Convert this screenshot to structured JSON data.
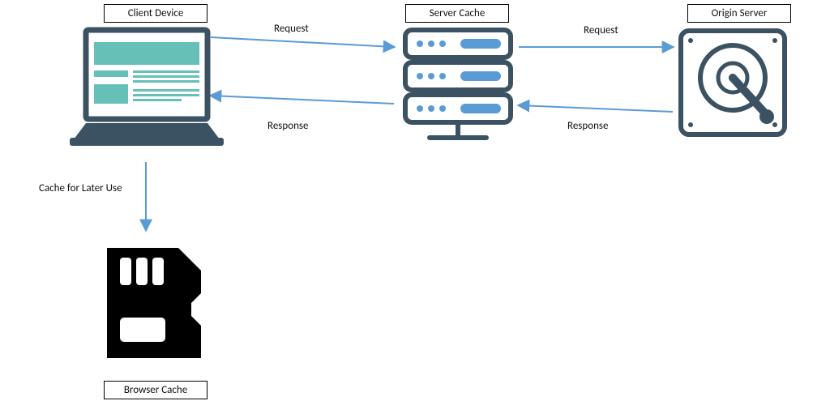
{
  "nodes": {
    "client": {
      "label": "Client Device"
    },
    "server_cache": {
      "label": "Server Cache"
    },
    "origin": {
      "label": "Origin Server"
    },
    "browser_cache": {
      "label": "Browser Cache"
    }
  },
  "edges": {
    "client_to_servercache": {
      "label": "Request"
    },
    "servercache_to_origin": {
      "label": "Request"
    },
    "origin_to_servercache": {
      "label": "Response"
    },
    "servercache_to_client": {
      "label": "Response"
    },
    "client_to_browsercache": {
      "label": "Cache for Later Use"
    }
  },
  "colors": {
    "arrow": "#5b9bd5",
    "laptop_body": "#3b5263",
    "laptop_screen_bg": "#ffffff",
    "laptop_content": "#66c0b7",
    "server_body": "#3b5263",
    "server_light": "#5b9bd5",
    "origin_stroke": "#3b5263",
    "sd_card": "#000000"
  }
}
